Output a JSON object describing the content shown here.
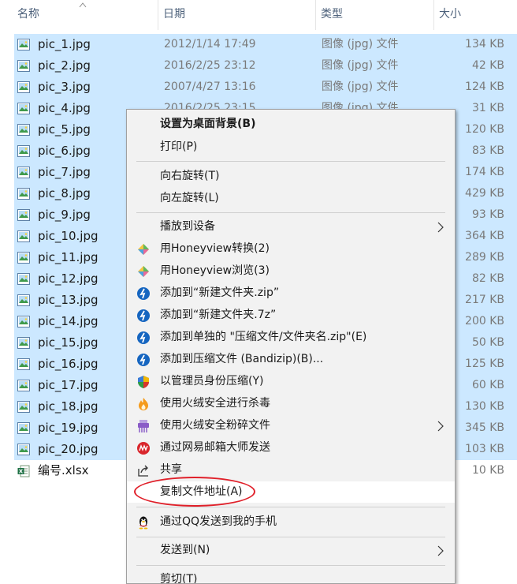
{
  "header": {
    "col_name": "名称",
    "col_date": "日期",
    "col_type": "类型",
    "col_size": "大小",
    "sort_icon": "sort-up-icon"
  },
  "files": [
    {
      "name": "pic_1.jpg",
      "date": "2012/1/14 17:49",
      "type": "图像 (jpg) 文件",
      "size": "134 KB",
      "selected": true
    },
    {
      "name": "pic_2.jpg",
      "date": "2016/2/25 23:12",
      "type": "图像 (jpg) 文件",
      "size": "42 KB",
      "selected": true
    },
    {
      "name": "pic_3.jpg",
      "date": "2007/4/27 13:16",
      "type": "图像 (jpg) 文件",
      "size": "124 KB",
      "selected": true
    },
    {
      "name": "pic_4.jpg",
      "date": "2016/2/25 23:15",
      "type": "图像 (jpg) 文件",
      "size": "31 KB",
      "selected": true
    },
    {
      "name": "pic_5.jpg",
      "date": "",
      "type": "",
      "size": "120 KB",
      "selected": true
    },
    {
      "name": "pic_6.jpg",
      "date": "",
      "type": "",
      "size": "83 KB",
      "selected": true
    },
    {
      "name": "pic_7.jpg",
      "date": "",
      "type": "",
      "size": "174 KB",
      "selected": true
    },
    {
      "name": "pic_8.jpg",
      "date": "",
      "type": "",
      "size": "429 KB",
      "selected": true
    },
    {
      "name": "pic_9.jpg",
      "date": "",
      "type": "",
      "size": "93 KB",
      "selected": true
    },
    {
      "name": "pic_10.jpg",
      "date": "",
      "type": "",
      "size": "364 KB",
      "selected": true
    },
    {
      "name": "pic_11.jpg",
      "date": "",
      "type": "",
      "size": "289 KB",
      "selected": true
    },
    {
      "name": "pic_12.jpg",
      "date": "",
      "type": "",
      "size": "82 KB",
      "selected": true
    },
    {
      "name": "pic_13.jpg",
      "date": "",
      "type": "",
      "size": "217 KB",
      "selected": true
    },
    {
      "name": "pic_14.jpg",
      "date": "",
      "type": "",
      "size": "200 KB",
      "selected": true
    },
    {
      "name": "pic_15.jpg",
      "date": "",
      "type": "",
      "size": "50 KB",
      "selected": true
    },
    {
      "name": "pic_16.jpg",
      "date": "",
      "type": "",
      "size": "125 KB",
      "selected": true
    },
    {
      "name": "pic_17.jpg",
      "date": "",
      "type": "",
      "size": "60 KB",
      "selected": true
    },
    {
      "name": "pic_18.jpg",
      "date": "",
      "type": "",
      "size": "130 KB",
      "selected": true
    },
    {
      "name": "pic_19.jpg",
      "date": "",
      "type": "",
      "size": "345 KB",
      "selected": true
    },
    {
      "name": "pic_20.jpg",
      "date": "",
      "type": "",
      "size": "103 KB",
      "selected": true
    },
    {
      "name": "编号.xlsx",
      "date": "",
      "type": "",
      "size": "10 KB",
      "selected": false
    }
  ],
  "context_menu": {
    "set_wallpaper": "设置为桌面背景(B)",
    "print": "打印(P)",
    "rotate_right": "向右旋转(T)",
    "rotate_left": "向左旋转(L)",
    "cast_to_device": "播放到设备",
    "honeyview_convert": "用Honeyview转换(2)",
    "honeyview_view": "用Honeyview浏览(3)",
    "add_zip": "添加到“新建文件夹.zip”",
    "add_7z": "添加到“新建文件夹.7z”",
    "add_each": "添加到单独的 \"压缩文件/文件夹名.zip\"(E)",
    "add_bandizip": "添加到压缩文件 (Bandizip)(B)...",
    "admin_compress": "以管理员身份压缩(Y)",
    "huorong_scan": "使用火绒安全进行杀毒",
    "huorong_shred": "使用火绒安全粉碎文件",
    "netease_send": "通过网易邮箱大师发送",
    "share": "共享",
    "copy_path": "复制文件地址(A)",
    "qq_send": "通过QQ发送到我的手机",
    "send_to": "发送到(N)",
    "cut": "剪切(T)"
  },
  "colors": {
    "selection": "#cce8ff",
    "menu_bg": "#f2f2f2",
    "highlight_ellipse": "#e0202a"
  }
}
